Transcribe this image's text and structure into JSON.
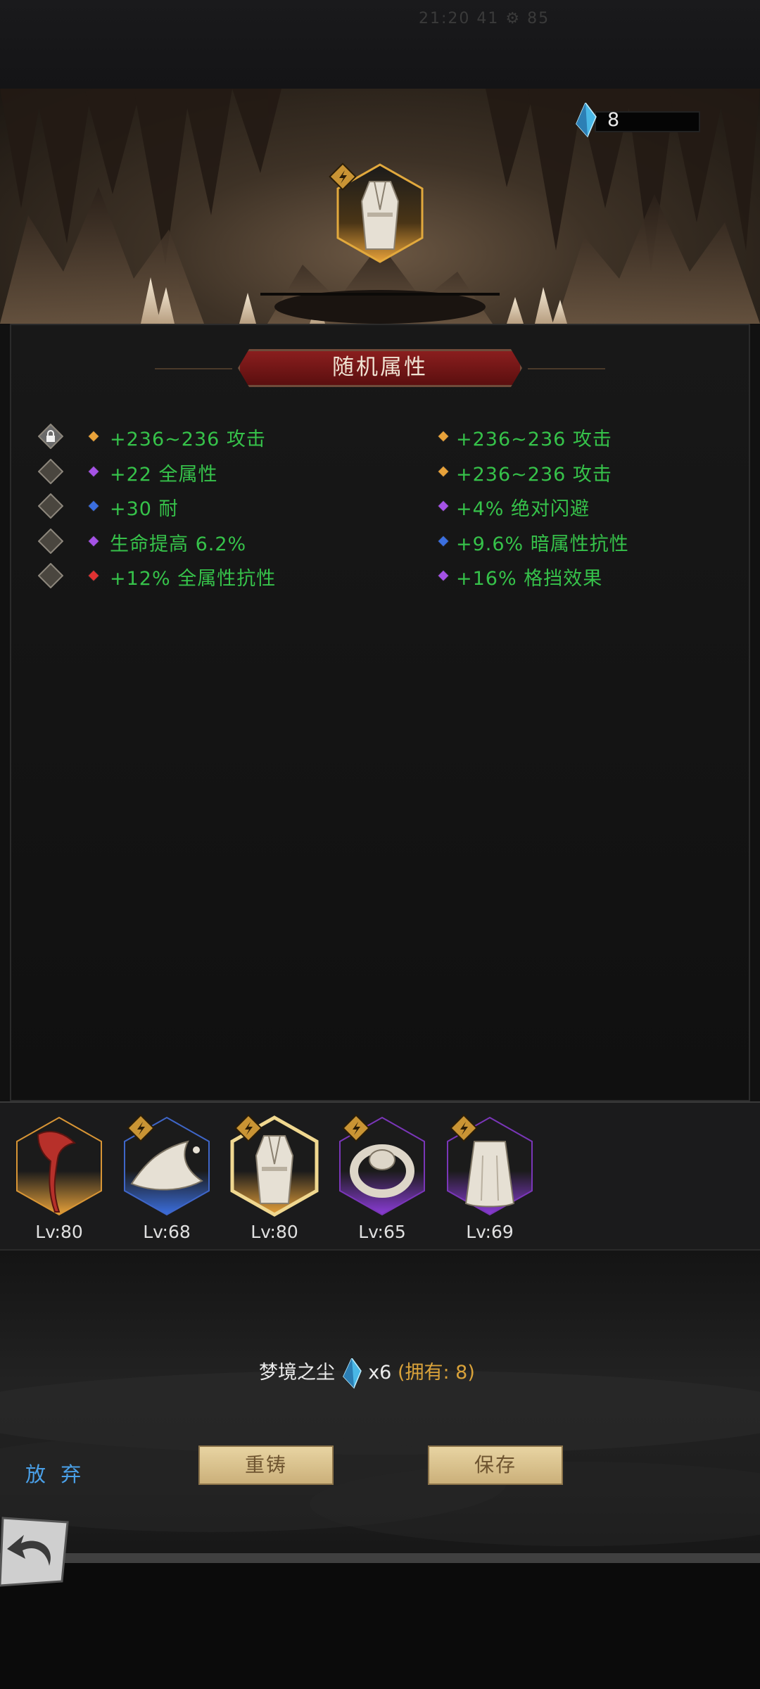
{
  "status_bar_text": "21:20  41  ⚙ 85",
  "currency": {
    "value": "8",
    "icon": "blue-crystal-icon"
  },
  "panel": {
    "title": "随机属性"
  },
  "attributes": {
    "left": [
      {
        "text": "+236~236 攻击",
        "gem": "orange-gem-icon",
        "locked": true
      },
      {
        "text": "+22 全属性",
        "gem": "purple-gem-icon",
        "locked": false
      },
      {
        "text": "+30 耐",
        "gem": "blue-gem-icon",
        "locked": false
      },
      {
        "text": "生命提高 6.2%",
        "gem": "purple-gem-icon",
        "locked": false
      },
      {
        "text": "+12% 全属性抗性",
        "gem": "red-gem-icon",
        "locked": false
      }
    ],
    "right": [
      {
        "text": "+236~236 攻击",
        "gem": "orange-gem-icon"
      },
      {
        "text": "+236~236 攻击",
        "gem": "orange-gem-icon"
      },
      {
        "text": "+4% 绝对闪避",
        "gem": "purple-gem-icon"
      },
      {
        "text": "+9.6% 暗属性抗性",
        "gem": "blue-gem-icon"
      },
      {
        "text": "+16% 格挡效果",
        "gem": "purple-gem-icon"
      }
    ]
  },
  "equipment": [
    {
      "name": "red-dragon-weapon",
      "level": "Lv:80",
      "rarity": "orange",
      "badge": false
    },
    {
      "name": "wizard-hat",
      "level": "Lv:68",
      "rarity": "blue",
      "badge": true
    },
    {
      "name": "robe-armor",
      "level": "Lv:80",
      "rarity": "orange",
      "badge": true,
      "selected": true
    },
    {
      "name": "ring",
      "level": "Lv:65",
      "rarity": "purple",
      "badge": true
    },
    {
      "name": "cloak",
      "level": "Lv:69",
      "rarity": "purple",
      "badge": true
    }
  ],
  "cost": {
    "label": "梦境之尘",
    "multiplier": "x6",
    "owned": "(拥有: 8)"
  },
  "buttons": {
    "discard": "放 弃",
    "reforge": "重铸",
    "save": "保存"
  },
  "colors": {
    "attr_green": "#36c24a",
    "orange": "#e8a23a",
    "purple": "#8b3cd8",
    "blue": "#3b6fe0",
    "title_red": "#7a1818"
  }
}
